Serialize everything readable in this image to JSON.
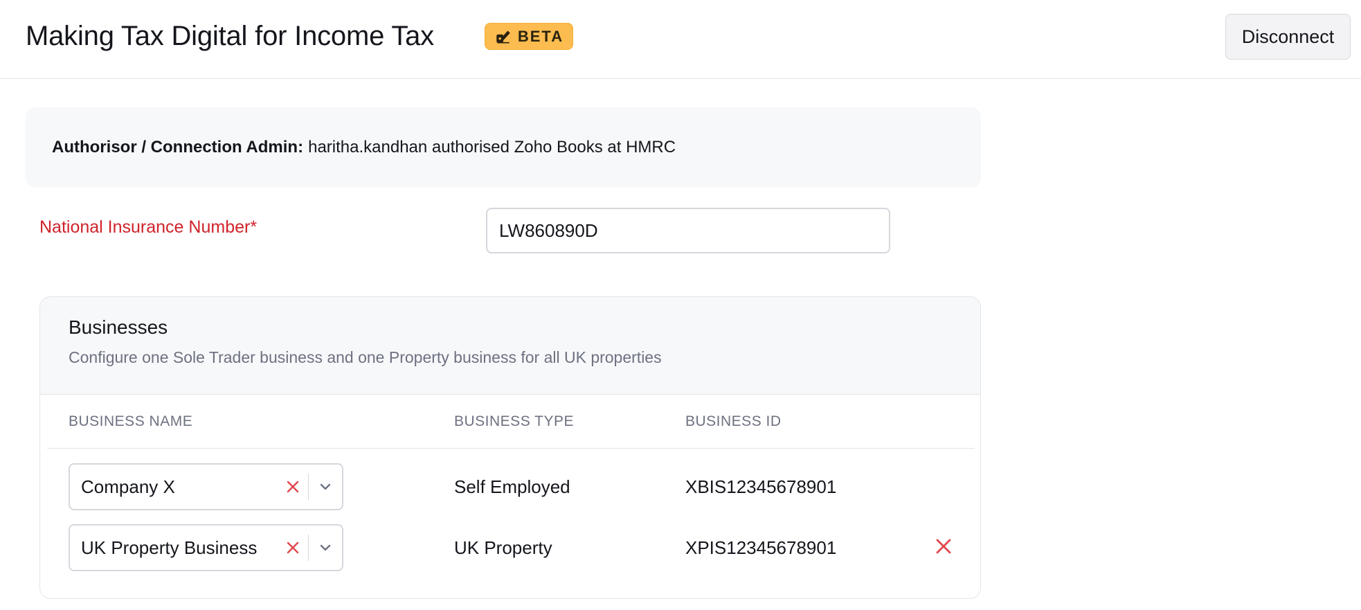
{
  "header": {
    "title": "Making Tax Digital for Income Tax",
    "badge": "BETA",
    "badge_icon": "beta-flask-icon",
    "disconnect_label": "Disconnect"
  },
  "auth": {
    "label": "Authorisor / Connection Admin:",
    "text": "haritha.kandhan authorised Zoho Books at HMRC"
  },
  "nin": {
    "label": "National Insurance Number*",
    "value": "LW860890D"
  },
  "businesses": {
    "title": "Businesses",
    "subtitle": "Configure one Sole Trader business and one Property business for all UK properties",
    "columns": [
      "BUSINESS NAME",
      "BUSINESS TYPE",
      "BUSINESS ID"
    ],
    "rows": [
      {
        "name": "Company X",
        "type": "Self Employed",
        "id": "XBIS12345678901"
      },
      {
        "name": "UK Property Business",
        "type": "UK Property",
        "id": "XPIS12345678901"
      }
    ]
  },
  "colors": {
    "accent_badge": "#fdbc4f",
    "required_label": "#d0222a",
    "remove_icon": "#e0474c"
  }
}
